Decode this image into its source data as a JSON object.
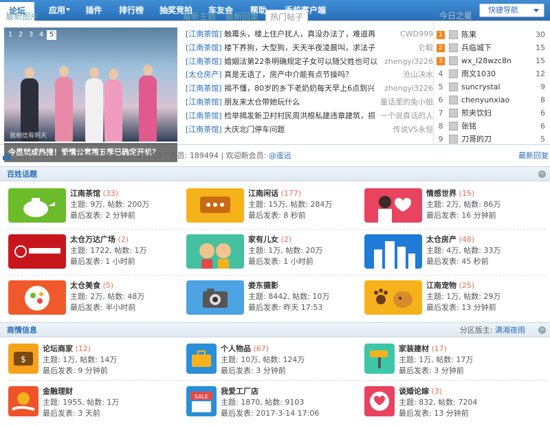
{
  "nav": {
    "items": [
      "论坛",
      "应用",
      "插件",
      "排行榜",
      "抽奖竞拍",
      "车友会",
      "帮助",
      "手机客户端"
    ],
    "quick_nav": "快捷导航"
  },
  "slideshow": {
    "numbers": [
      "1",
      "2",
      "3",
      "4",
      "5"
    ],
    "caption": "今星就成热搜！爱情公寓第五季已确定开机？",
    "logo": "我相信有明天"
  },
  "tabs": [
    "最新图片",
    "最新主题",
    "最新回复",
    "热门帖子"
  ],
  "threads": [
    {
      "cat": "[江南茶馆]",
      "title": "触霉头，楼上住户扰人，真没办法了，难道再",
      "author": "CWD999"
    },
    {
      "cat": "[江南茶馆]",
      "title": "楼下养狗，大型狗，天天半夜凌晨叫，求法子",
      "author": "仑毅"
    },
    {
      "cat": "[江南茶馆]",
      "title": "婚姻法第22条明确规定子女可以随父姓也可以",
      "author": "zhengyi3226"
    },
    {
      "cat": "[太仓房产]",
      "title": "真是无语了，房产中介能有点节操吗？",
      "author": "沧山决水"
    },
    {
      "cat": "[江南茶馆]",
      "title": "揭不懂，80岁的乡下老奶奶每天早上6点到兴",
      "author": "zhengyi3226"
    },
    {
      "cat": "[江南茶馆]",
      "title": "朋友来太仓带她玩什么",
      "author": "童话里的兔小姐"
    },
    {
      "cat": "[江南茶馆]",
      "title": "检举揭发新卫村村民周洪根私建违章建筑，损",
      "author": "一个说真话的人"
    },
    {
      "cat": "[江南茶馆]",
      "title": "大庆北门停车问题",
      "author": "传说VS永恒"
    }
  ],
  "stars": {
    "title": "今日之星",
    "list": [
      {
        "rank": "1",
        "name": "陈果",
        "count": "30"
      },
      {
        "rank": "2",
        "name": "兵临城下",
        "count": "15"
      },
      {
        "rank": "3",
        "name": "wx_I28wzc8n",
        "count": "15"
      },
      {
        "rank": "4",
        "name": "雨文1030",
        "count": "12"
      },
      {
        "rank": "5",
        "name": "suncrystal",
        "count": "9"
      },
      {
        "rank": "6",
        "name": "chenyunxiao",
        "count": "8"
      },
      {
        "rank": "7",
        "name": "煎夹饮妇",
        "count": "6"
      },
      {
        "rank": "8",
        "name": "张铭",
        "count": "6"
      },
      {
        "rank": "9",
        "name": "刀哥的刀",
        "count": "5"
      }
    ]
  },
  "stats": {
    "text": "今日: 450  |  昨日: 1854  |  帖子: 10426708  |  会员: 189494  |  欢迎新会员: ",
    "newest_member": "@遥远",
    "latest_link": "最新回复"
  },
  "section1": {
    "title": "百姓话题",
    "forums": [
      {
        "name": "江南茶馆",
        "count": "(33)",
        "line1": "主题: 9万, 帖数: 200万",
        "line2": "最后发表: 2 分钟前"
      },
      {
        "name": "江南闲话",
        "count": "(177)",
        "line1": "主题: 15万, 帖数: 284万",
        "line2": "最后发表: 8 秒前"
      },
      {
        "name": "情感世界",
        "count": "(15)",
        "line1": "主题: 2万, 帖数: 86万",
        "line2": "最后发表: 16 分钟前"
      },
      {
        "name": "太仓万达广场",
        "count": "(2)",
        "line1": "主题: 1722, 帖数: 1万",
        "line2": "最后发表: 1 小时前"
      },
      {
        "name": "家有儿女",
        "count": "(2)",
        "line1": "主题: 1万, 帖数: 20万",
        "line2": "最后发表: 1 小时前"
      },
      {
        "name": "太仓房产",
        "count": "(48)",
        "line1": "主题: 4万, 帖数: 33万",
        "line2": "最后发表: 45 秒前"
      },
      {
        "name": "太仓美食",
        "count": "(5)",
        "line1": "主题: 2万, 帖数: 48万",
        "line2": "最后发表: 半小时前"
      },
      {
        "name": "娄东摄影",
        "count": "",
        "line1": "主题: 8442, 帖数: 10万",
        "line2": "最后发表: 昨天 17:53"
      },
      {
        "name": "江南宠物",
        "count": "(25)",
        "line1": "主题: 1万, 帖数: 29万",
        "line2": "最后发表: 13 分钟前"
      }
    ]
  },
  "section2": {
    "title": "商情信息",
    "moderator_label": "分区版主: ",
    "moderator": "满湘夜雨",
    "forums": [
      {
        "name": "论坛商家",
        "count": "(12)",
        "line1": "主题: 1万, 帖数: 14万",
        "line2": "最后发表: 9 分钟前"
      },
      {
        "name": "个人物品",
        "count": "(67)",
        "line1": "主题: 10万, 帖数: 124万",
        "line2": "最后发表: 3 分钟前"
      },
      {
        "name": "家装建材",
        "count": "(17)",
        "line1": "主题: 1万, 帖数: 17万",
        "line2": "最后发表: 3 分钟前"
      },
      {
        "name": "金融理财",
        "count": "",
        "line1": "主题: 1955, 帖数: 1万",
        "line2": "最后发表: 3 天前"
      },
      {
        "name": "我爱工厂店",
        "count": "",
        "line1": "主题: 1870, 帖数: 9103",
        "line2": "最后发表: 2017-3-14 17:06"
      },
      {
        "name": "谈婚论嫁",
        "count": "(3)",
        "line1": "主题: 832, 帖数: 7204",
        "line2": "最后发表: 13 分钟前"
      }
    ]
  },
  "colors": {
    "nav_blue": "#2a6fb8",
    "count_red": "#f26c4f"
  }
}
